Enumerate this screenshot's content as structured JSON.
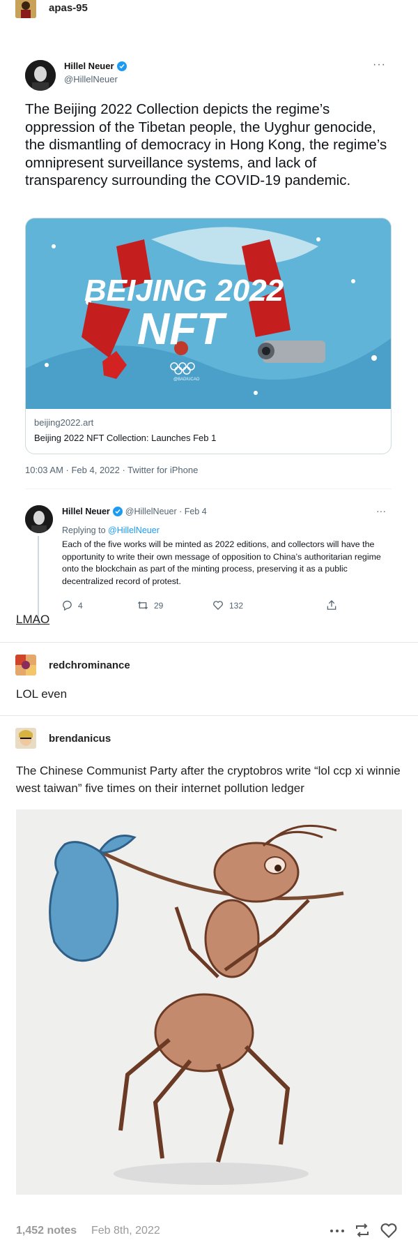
{
  "posts": [
    {
      "username": "apas-95"
    },
    {
      "username": "redchrominance",
      "text": "LOL even"
    },
    {
      "username": "brendanicus",
      "text": "The Chinese Communist Party after the cryptobros write “lol ccp xi winnie west taiwan” five times on their internet pollution ledger"
    }
  ],
  "tweet": {
    "author_name": "Hillel Neuer",
    "author_handle": "@HillelNeuer",
    "text": "The Beijing 2022 Collection depicts the regime’s oppression of the Tibetan people, the Uyghur genocide, the dismantling of democracy in Hong Kong, the regime’s omnipresent surveillance systems, and lack of transparency surrounding the COVID-19 pandemic.",
    "card": {
      "image_text_1": "BEIJING 2022",
      "image_text_2": "NFT",
      "image_credit": "@BADIUCAO",
      "domain": "beijing2022.art",
      "title": "Beijing 2022 NFT Collection: Launches Feb 1"
    },
    "meta": "10:03 AM · Feb 4, 2022 · Twitter for iPhone",
    "reply": {
      "author_name": "Hillel Neuer",
      "handle_date": "@HillelNeuer · Feb 4",
      "replying_prefix": "Replying to",
      "replying_to": "@HillelNeuer",
      "text": "Each of the five works will be minted as 2022 editions, and collectors will have the opportunity to write their own message of opposition to China’s authoritarian regime onto the blockchain as part of the minting process, preserving it as a public decentralized record of protest.",
      "replies": "4",
      "retweets": "29",
      "likes": "132"
    }
  },
  "reply_comment": "LMAO",
  "footer": {
    "notes": "1,452 notes",
    "date": "Feb 8th, 2022"
  },
  "colors": {
    "verified": "#1d9bf0",
    "card_sky": "#5fb4d8",
    "muted": "#9a9a9a"
  }
}
